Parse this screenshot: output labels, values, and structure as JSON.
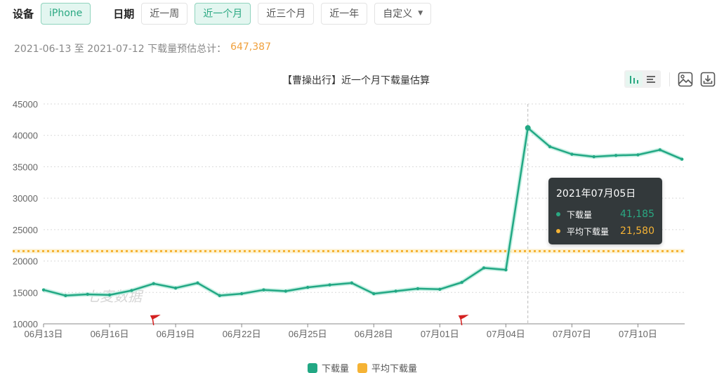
{
  "filters": {
    "device_label": "设备",
    "device_options": [
      {
        "label": "iPhone",
        "active": true
      }
    ],
    "date_label": "日期",
    "date_options": [
      {
        "label": "近一周",
        "active": false
      },
      {
        "label": "近一个月",
        "active": true
      },
      {
        "label": "近三个月",
        "active": false
      },
      {
        "label": "近一年",
        "active": false
      },
      {
        "label": "自定义",
        "active": false,
        "dropdown": true
      }
    ]
  },
  "summary": {
    "text": "2021-06-13 至 2021-07-12 下载量预估总计：",
    "total": "647,387"
  },
  "toolbar": {
    "icons": [
      "bar-chart-icon",
      "list-icon",
      "image-icon",
      "download-icon"
    ]
  },
  "colors": {
    "primary": "#22a884",
    "average": "#f5b335",
    "tooltip_bg": "#33393b"
  },
  "tooltip": {
    "date": "2021年07月05日",
    "rows": [
      {
        "name": "下载量",
        "value": "41,185",
        "color": "#2aa882"
      },
      {
        "name": "平均下载量",
        "value": "21,580",
        "color": "#f5b335"
      }
    ]
  },
  "watermark": "七麦数据",
  "chart_data": {
    "type": "line",
    "title": "【曹操出行】近一个月下载量估算",
    "xlabel": "",
    "ylabel": "",
    "ylim": [
      10000,
      45000
    ],
    "yticks": [
      10000,
      15000,
      20000,
      25000,
      30000,
      35000,
      40000,
      45000
    ],
    "ytick_labels": [
      "10000",
      "15000",
      "20000",
      "25000",
      "30000",
      "35000",
      "40000",
      "45000"
    ],
    "grid": true,
    "legend_position": "bottom-center",
    "x": [
      "06月13日",
      "06月14日",
      "06月15日",
      "06月16日",
      "06月17日",
      "06月18日",
      "06月19日",
      "06月20日",
      "06月21日",
      "06月22日",
      "06月23日",
      "06月24日",
      "06月25日",
      "06月26日",
      "06月27日",
      "06月28日",
      "06月29日",
      "06月30日",
      "07月01日",
      "07月02日",
      "07月03日",
      "07月04日",
      "07月05日",
      "07月06日",
      "07月07日",
      "07月08日",
      "07月09日",
      "07月10日",
      "07月11日",
      "07月12日"
    ],
    "xtick_labels": [
      "06月13日",
      "06月16日",
      "06月19日",
      "06月22日",
      "06月25日",
      "06月28日",
      "07月01日",
      "07月04日",
      "07月07日",
      "07月10日"
    ],
    "series": [
      {
        "name": "下载量",
        "color": "#22a884",
        "values": [
          15400,
          14500,
          14700,
          14600,
          15300,
          16400,
          15700,
          16500,
          14500,
          14800,
          15400,
          15200,
          15800,
          16200,
          16500,
          14800,
          15200,
          15600,
          15500,
          16600,
          18900,
          18600,
          41185,
          38200,
          37000,
          36600,
          36800,
          36900,
          37700,
          36200
        ]
      },
      {
        "name": "平均下载量",
        "color": "#f5b335",
        "constant": 21580
      }
    ],
    "markers": [
      {
        "type": "flag",
        "x": "06月18日",
        "color": "#d42020"
      },
      {
        "type": "flag",
        "x": "07月02日",
        "color": "#d42020"
      }
    ],
    "highlight_x": "07月05日"
  }
}
